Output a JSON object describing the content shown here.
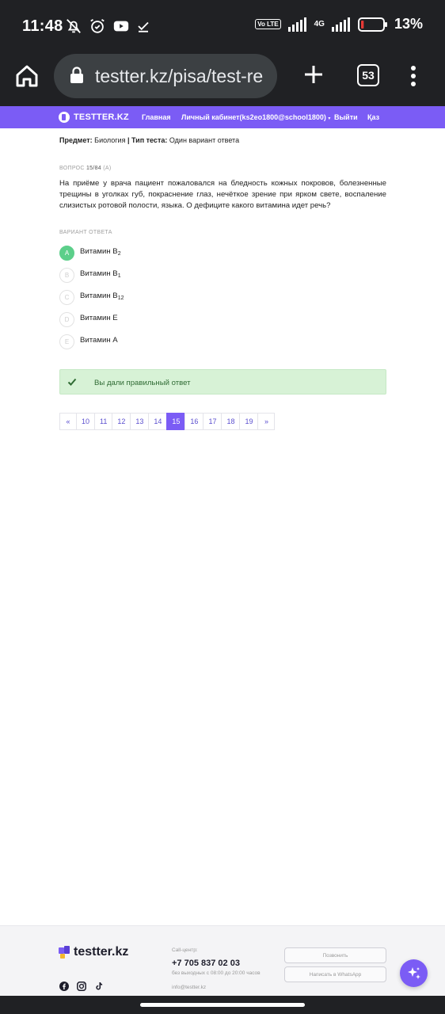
{
  "status_bar": {
    "time": "11:48",
    "volte": "Vo LTE",
    "network": "4G",
    "battery_percent": "13%",
    "battery_level": 0.13
  },
  "browser": {
    "url": "testter.kz/pisa/test-re",
    "tab_count": "53"
  },
  "site_nav": {
    "logo": "TESTTER.KZ",
    "items": [
      "Главная",
      "Личный кабинет(ks2eo1800@school1800)",
      "Выйти",
      "Қаз"
    ]
  },
  "meta": {
    "subject_label": "Предмет:",
    "subject_value": "Биология",
    "separator": "|",
    "type_label": "Тип теста:",
    "type_value": "Один вариант ответа"
  },
  "question": {
    "number_prefix": "ВОПРОС",
    "number": "15/84",
    "tag": "(A)",
    "text": "На приёме у врача пациент пожаловался на бледность кожных покровов, болезненные трещины в уголках губ, покраснение глаз, нечёткое зрение при ярком свете, воспаление слизистых ротовой полости, языка. О дефиците какого витамина идет речь?"
  },
  "answers_label": "ВАРИАНТ ОТВЕТА",
  "options": [
    {
      "letter": "A",
      "text": "Витамин B",
      "sub": "2",
      "correct": true
    },
    {
      "letter": "B",
      "text": "Витамин B",
      "sub": "1",
      "correct": false
    },
    {
      "letter": "C",
      "text": "Витамин B",
      "sub": "12",
      "correct": false
    },
    {
      "letter": "D",
      "text": "Витамин E",
      "sub": "",
      "correct": false
    },
    {
      "letter": "E",
      "text": "Витамин A",
      "sub": "",
      "correct": false
    }
  ],
  "result_alert": "Вы дали правильный ответ",
  "pagination": {
    "prev": "«",
    "pages": [
      "10",
      "11",
      "12",
      "13",
      "14",
      "15",
      "16",
      "17",
      "18",
      "19"
    ],
    "active": "15",
    "next": "»"
  },
  "footer": {
    "logo": "testter.kz",
    "call_center_label": "Call-центр:",
    "phone": "+7 705 837 02 03",
    "hours": "без выходных с 08:00 до 20:00 часов",
    "email": "info@testter.kz",
    "call_button": "Позвонить",
    "whatsapp_button": "Написать в WhatsApp"
  },
  "colors": {
    "brand": "#7b5cf5",
    "correct": "#5ccf8a",
    "alert_bg": "#d7f2d6",
    "browser_chrome": "#202124"
  }
}
